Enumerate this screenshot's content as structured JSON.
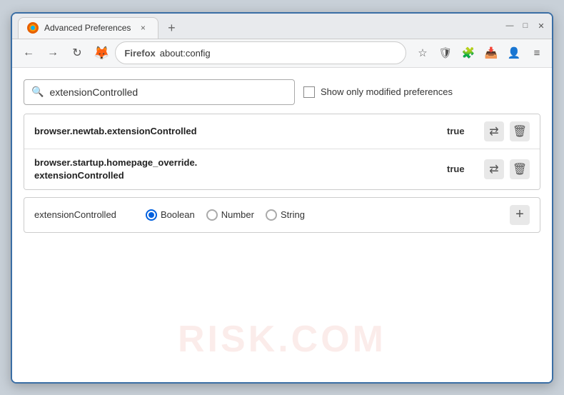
{
  "window": {
    "title": "Advanced Preferences",
    "tab_close": "×",
    "new_tab": "+",
    "win_minimize": "—",
    "win_restore": "□",
    "win_close": "✕"
  },
  "navbar": {
    "back": "←",
    "forward": "→",
    "reload": "↻",
    "browser_name": "Firefox",
    "address": "about:config",
    "menu": "≡"
  },
  "search": {
    "placeholder": "extensionControlled",
    "value": "extensionControlled",
    "checkbox_label": "Show only modified preferences"
  },
  "results": [
    {
      "name": "browser.newtab.extensionControlled",
      "value": "true"
    },
    {
      "name_line1": "browser.startup.homepage_override.",
      "name_line2": "extensionControlled",
      "value": "true"
    }
  ],
  "add_row": {
    "name": "extensionControlled",
    "type_options": [
      "Boolean",
      "Number",
      "String"
    ],
    "selected_type": "Boolean",
    "add_btn": "+"
  },
  "watermark": "RISK.COM",
  "icons": {
    "search": "🔍",
    "bookmark": "☆",
    "shield": "🛡",
    "extension": "🧩",
    "download": "📥",
    "menu_icon": "≡",
    "reset": "⇄",
    "delete": "🗑",
    "firefox_circle": "🦊"
  }
}
